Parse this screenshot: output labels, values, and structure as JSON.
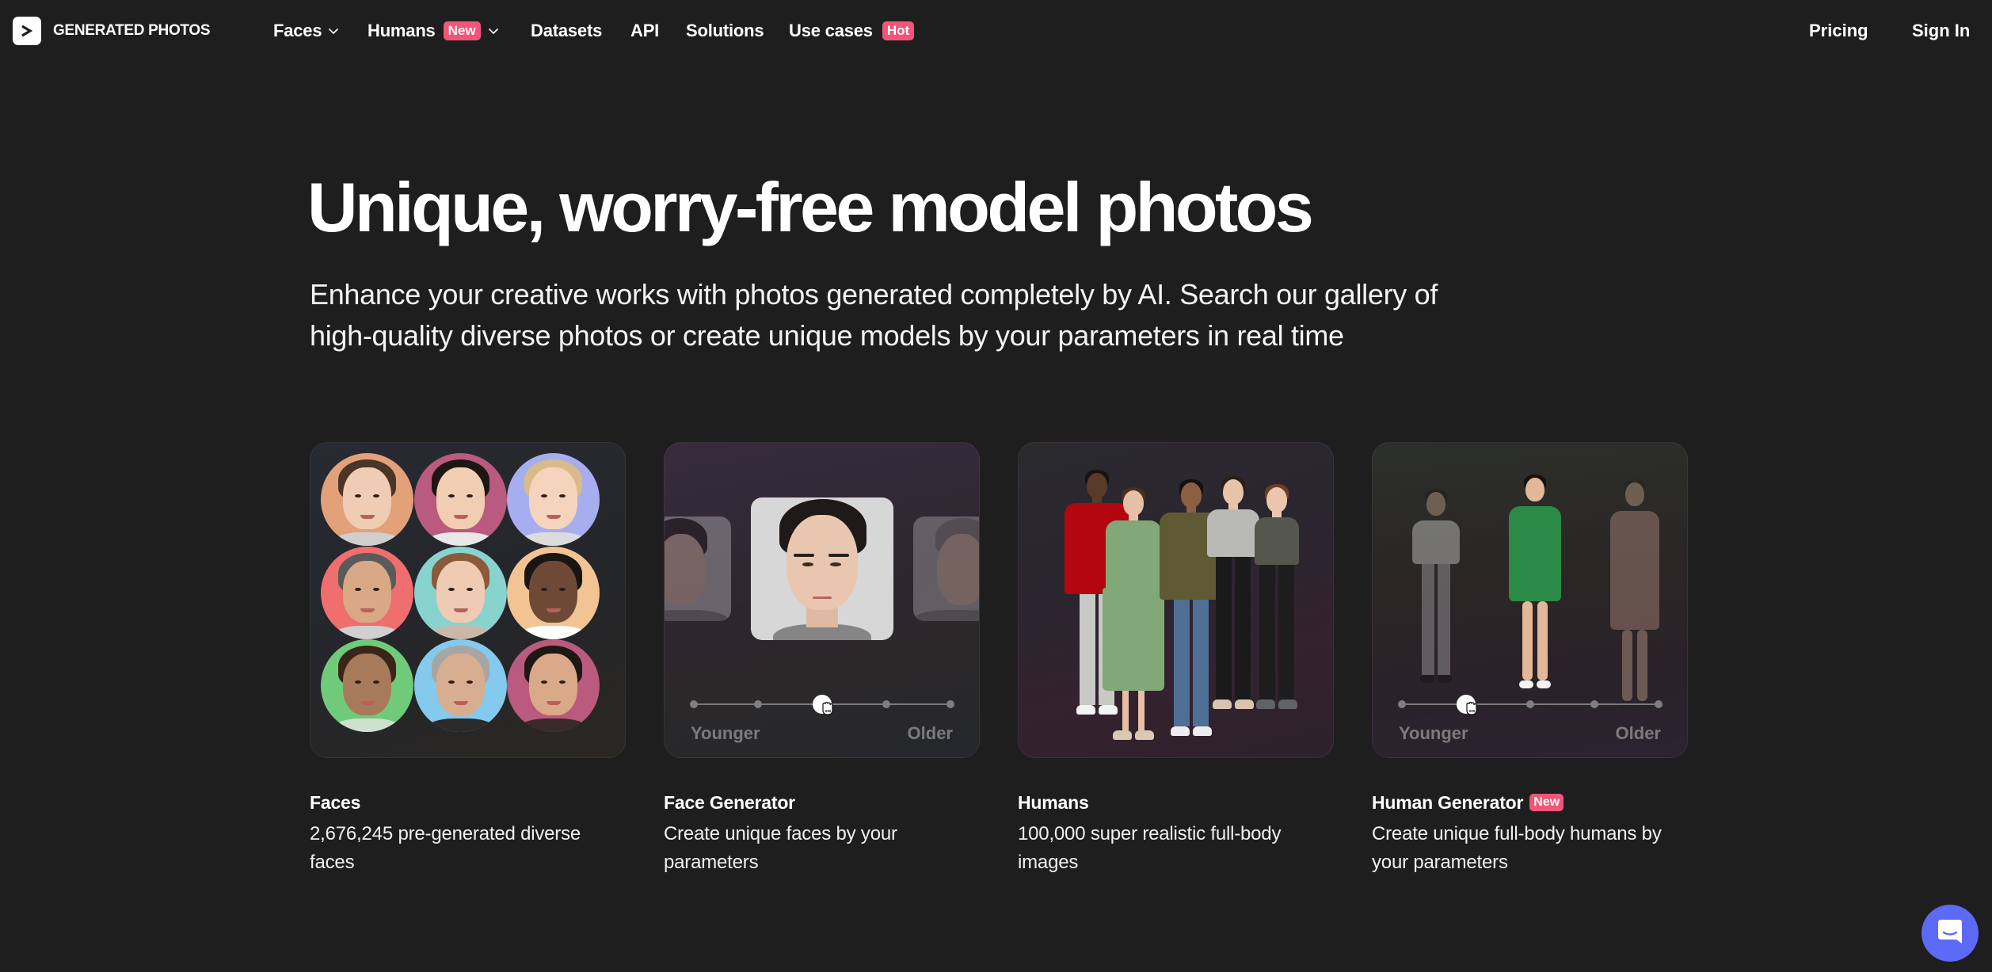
{
  "nav": {
    "logo_text": "GENERATED PHOTOS",
    "logo_icon": "chevron-right-icon",
    "items": [
      {
        "label": "Faces",
        "has_dropdown": true
      },
      {
        "label": "Humans",
        "badge": "New",
        "has_dropdown": true
      },
      {
        "label": "Datasets"
      },
      {
        "label": "API"
      },
      {
        "label": "Solutions"
      },
      {
        "label": "Use cases",
        "badge": "Hot"
      }
    ],
    "pricing": "Pricing",
    "sign_in": "Sign In"
  },
  "hero": {
    "title": "Unique, worry-free model photos",
    "subtitle_line1": "Enhance your creative works with photos generated completely by AI. Search our gallery of",
    "subtitle_line2": "high-quality diverse photos or create unique models by your parameters in real time"
  },
  "cards": [
    {
      "title": "Faces",
      "description_line1": "2,676,245 pre-generated diverse",
      "description_line2": "faces",
      "circle_colors": [
        "#e3a17a",
        "#b95a7e",
        "#a7aef0",
        "#ef6f6e",
        "#89d3cf",
        "#f2c493",
        "#6fcb79",
        "#84c9ee",
        "#b95a7e"
      ]
    },
    {
      "title": "Face Generator",
      "description_line1": "Create unique faces by your",
      "description_line2": "parameters",
      "slider": {
        "min_label": "Younger",
        "max_label": "Older",
        "steps": 5,
        "value_step": 3
      }
    },
    {
      "title": "Humans",
      "description_line1": "100,000 super realistic full-body",
      "description_line2": "images"
    },
    {
      "title": "Human Generator",
      "badge": "New",
      "description_line1": "Create unique full-body humans by",
      "description_line2": "your parameters",
      "slider": {
        "min_label": "Younger",
        "max_label": "Older",
        "steps": 5,
        "value_step": 2
      }
    }
  ],
  "chat": {
    "icon": "chat-bubble-icon"
  },
  "colors": {
    "background": "#1e1e1e",
    "badge": "#f25577",
    "chat_button": "#5d6af5",
    "slider_label": "#7c7a7c"
  }
}
